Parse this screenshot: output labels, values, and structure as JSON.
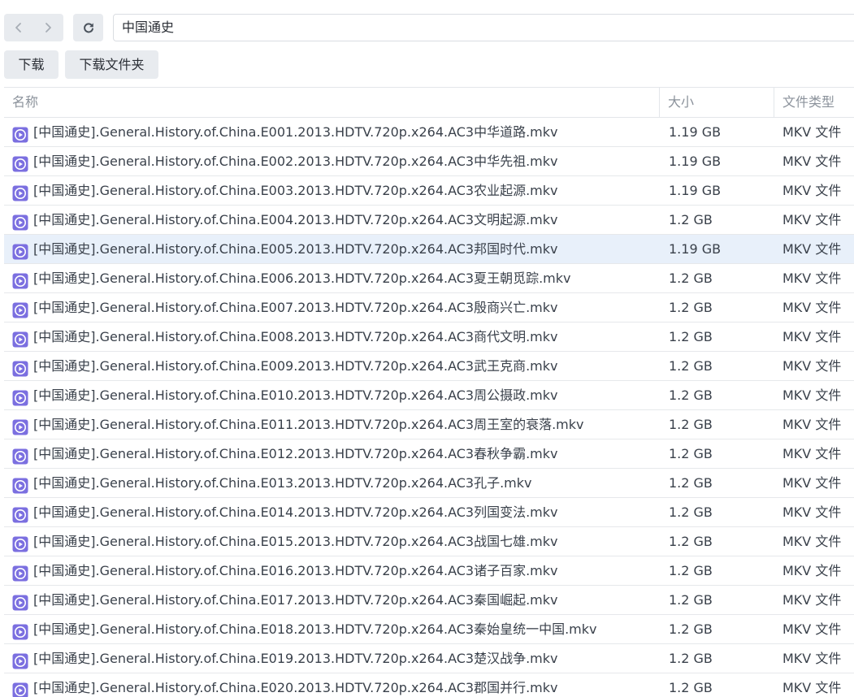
{
  "toolbar": {
    "back_icon": "chevron-left-icon",
    "forward_icon": "chevron-right-icon",
    "refresh_icon": "refresh-icon",
    "path_value": "中国通史",
    "download_label": "下载",
    "download_folder_label": "下载文件夹"
  },
  "table": {
    "columns": {
      "name": "名称",
      "size": "大小",
      "type": "文件类型"
    },
    "file_icon": "video-file-icon",
    "selected_row": 4,
    "rows": [
      {
        "name": "[中国通史].General.History.of.China.E001.2013.HDTV.720p.x264.AC3中华道路.mkv",
        "size": "1.19 GB",
        "type": "MKV 文件"
      },
      {
        "name": "[中国通史].General.History.of.China.E002.2013.HDTV.720p.x264.AC3中华先祖.mkv",
        "size": "1.19 GB",
        "type": "MKV 文件"
      },
      {
        "name": "[中国通史].General.History.of.China.E003.2013.HDTV.720p.x264.AC3农业起源.mkv",
        "size": "1.19 GB",
        "type": "MKV 文件"
      },
      {
        "name": "[中国通史].General.History.of.China.E004.2013.HDTV.720p.x264.AC3文明起源.mkv",
        "size": "1.2 GB",
        "type": "MKV 文件"
      },
      {
        "name": "[中国通史].General.History.of.China.E005.2013.HDTV.720p.x264.AC3邦国时代.mkv",
        "size": "1.19 GB",
        "type": "MKV 文件"
      },
      {
        "name": "[中国通史].General.History.of.China.E006.2013.HDTV.720p.x264.AC3夏王朝觅踪.mkv",
        "size": "1.2 GB",
        "type": "MKV 文件"
      },
      {
        "name": "[中国通史].General.History.of.China.E007.2013.HDTV.720p.x264.AC3殷商兴亡.mkv",
        "size": "1.2 GB",
        "type": "MKV 文件"
      },
      {
        "name": "[中国通史].General.History.of.China.E008.2013.HDTV.720p.x264.AC3商代文明.mkv",
        "size": "1.2 GB",
        "type": "MKV 文件"
      },
      {
        "name": "[中国通史].General.History.of.China.E009.2013.HDTV.720p.x264.AC3武王克商.mkv",
        "size": "1.2 GB",
        "type": "MKV 文件"
      },
      {
        "name": "[中国通史].General.History.of.China.E010.2013.HDTV.720p.x264.AC3周公摄政.mkv",
        "size": "1.2 GB",
        "type": "MKV 文件"
      },
      {
        "name": "[中国通史].General.History.of.China.E011.2013.HDTV.720p.x264.AC3周王室的衰落.mkv",
        "size": "1.2 GB",
        "type": "MKV 文件"
      },
      {
        "name": "[中国通史].General.History.of.China.E012.2013.HDTV.720p.x264.AC3春秋争霸.mkv",
        "size": "1.2 GB",
        "type": "MKV 文件"
      },
      {
        "name": "[中国通史].General.History.of.China.E013.2013.HDTV.720p.x264.AC3孔子.mkv",
        "size": "1.2 GB",
        "type": "MKV 文件"
      },
      {
        "name": "[中国通史].General.History.of.China.E014.2013.HDTV.720p.x264.AC3列国变法.mkv",
        "size": "1.2 GB",
        "type": "MKV 文件"
      },
      {
        "name": "[中国通史].General.History.of.China.E015.2013.HDTV.720p.x264.AC3战国七雄.mkv",
        "size": "1.2 GB",
        "type": "MKV 文件"
      },
      {
        "name": "[中国通史].General.History.of.China.E016.2013.HDTV.720p.x264.AC3诸子百家.mkv",
        "size": "1.2 GB",
        "type": "MKV 文件"
      },
      {
        "name": "[中国通史].General.History.of.China.E017.2013.HDTV.720p.x264.AC3秦国崛起.mkv",
        "size": "1.2 GB",
        "type": "MKV 文件"
      },
      {
        "name": "[中国通史].General.History.of.China.E018.2013.HDTV.720p.x264.AC3秦始皇统一中国.mkv",
        "size": "1.2 GB",
        "type": "MKV 文件"
      },
      {
        "name": "[中国通史].General.History.of.China.E019.2013.HDTV.720p.x264.AC3楚汉战争.mkv",
        "size": "1.2 GB",
        "type": "MKV 文件"
      },
      {
        "name": "[中国通史].General.History.of.China.E020.2013.HDTV.720p.x264.AC3郡国并行.mkv",
        "size": "1.2 GB",
        "type": "MKV 文件"
      }
    ]
  }
}
